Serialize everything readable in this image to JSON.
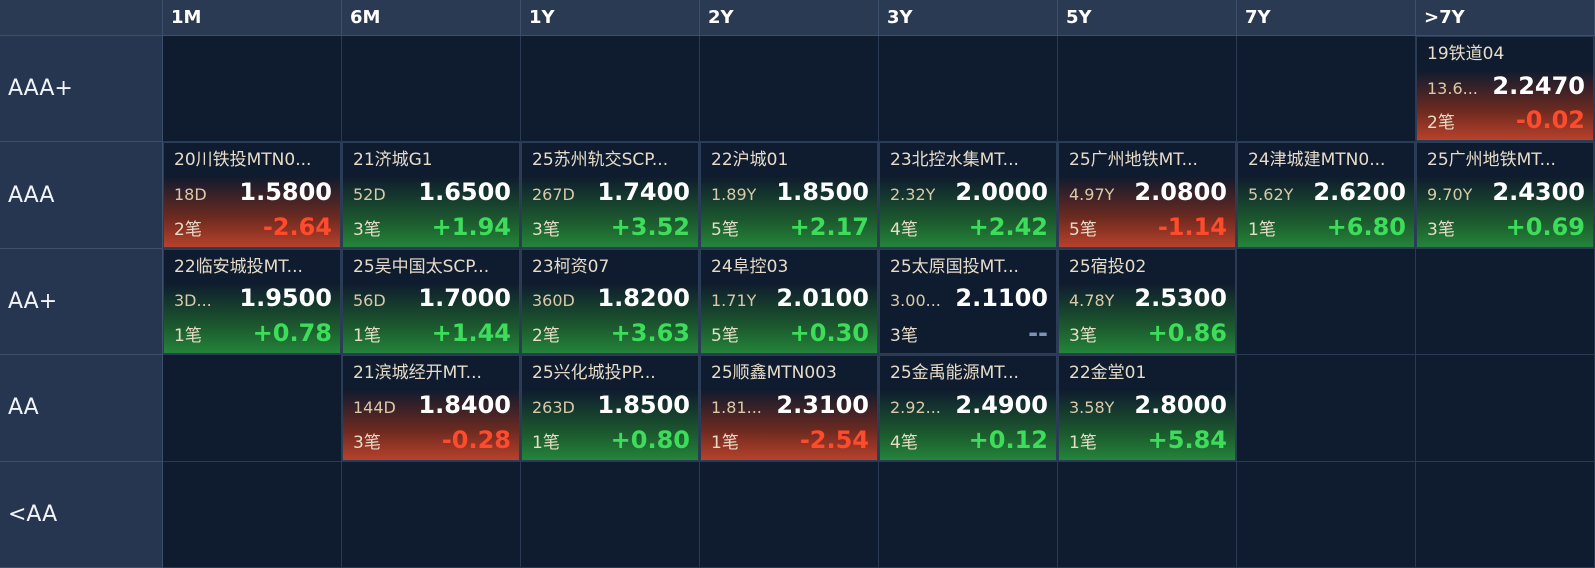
{
  "columns": [
    "1M",
    "6M",
    "1Y",
    "2Y",
    "3Y",
    "5Y",
    "7Y",
    ">7Y"
  ],
  "rows": [
    {
      "label": "AAA+",
      "cells": [
        null,
        null,
        null,
        null,
        null,
        null,
        null,
        {
          "name": "19铁道04",
          "term": "13.6...",
          "price": "2.2470",
          "count": "2笔",
          "change": "-0.02",
          "trend": "down"
        }
      ]
    },
    {
      "label": "AAA",
      "cells": [
        {
          "name": "20川铁投MTN0...",
          "term": "18D",
          "price": "1.5800",
          "count": "2笔",
          "change": "-2.64",
          "trend": "down"
        },
        {
          "name": "21济城G1",
          "term": "52D",
          "price": "1.6500",
          "count": "3笔",
          "change": "+1.94",
          "trend": "up"
        },
        {
          "name": "25苏州轨交SCP...",
          "term": "267D",
          "price": "1.7400",
          "count": "3笔",
          "change": "+3.52",
          "trend": "up"
        },
        {
          "name": "22沪城01",
          "term": "1.89Y",
          "price": "1.8500",
          "count": "5笔",
          "change": "+2.17",
          "trend": "up"
        },
        {
          "name": "23北控水集MT...",
          "term": "2.32Y",
          "price": "2.0000",
          "count": "4笔",
          "change": "+2.42",
          "trend": "up"
        },
        {
          "name": "25广州地铁MT...",
          "term": "4.97Y",
          "price": "2.0800",
          "count": "5笔",
          "change": "-1.14",
          "trend": "down"
        },
        {
          "name": "24津城建MTN0...",
          "term": "5.62Y",
          "price": "2.6200",
          "count": "1笔",
          "change": "+6.80",
          "trend": "up"
        },
        {
          "name": "25广州地铁MT...",
          "term": "9.70Y",
          "price": "2.4300",
          "count": "3笔",
          "change": "+0.69",
          "trend": "up"
        }
      ]
    },
    {
      "label": "AA+",
      "cells": [
        {
          "name": "22临安城投MT...",
          "term": "3D...",
          "price": "1.9500",
          "count": "1笔",
          "change": "+0.78",
          "trend": "up"
        },
        {
          "name": "25吴中国太SCP...",
          "term": "56D",
          "price": "1.7000",
          "count": "1笔",
          "change": "+1.44",
          "trend": "up"
        },
        {
          "name": "23柯资07",
          "term": "360D",
          "price": "1.8200",
          "count": "2笔",
          "change": "+3.63",
          "trend": "up"
        },
        {
          "name": "24阜控03",
          "term": "1.71Y",
          "price": "2.0100",
          "count": "5笔",
          "change": "+0.30",
          "trend": "up"
        },
        {
          "name": "25太原国投MT...",
          "term": "3.00...",
          "price": "2.1100",
          "count": "3笔",
          "change": "--",
          "trend": "flat"
        },
        {
          "name": "25宿投02",
          "term": "4.78Y",
          "price": "2.5300",
          "count": "3笔",
          "change": "+0.86",
          "trend": "up"
        },
        null,
        null
      ]
    },
    {
      "label": "AA",
      "cells": [
        null,
        {
          "name": "21滨城经开MT...",
          "term": "144D",
          "price": "1.8400",
          "count": "3笔",
          "change": "-0.28",
          "trend": "down"
        },
        {
          "name": "25兴化城投PP...",
          "term": "263D",
          "price": "1.8500",
          "count": "1笔",
          "change": "+0.80",
          "trend": "up"
        },
        {
          "name": "25顺鑫MTN003",
          "term": "1.81...",
          "price": "2.3100",
          "count": "1笔",
          "change": "-2.54",
          "trend": "down"
        },
        {
          "name": "25金禹能源MT...",
          "term": "2.92...",
          "price": "2.4900",
          "count": "4笔",
          "change": "+0.12",
          "trend": "up"
        },
        {
          "name": "22金堂01",
          "term": "3.58Y",
          "price": "2.8000",
          "count": "1笔",
          "change": "+5.84",
          "trend": "up"
        },
        null,
        null
      ]
    },
    {
      "label": "<AA",
      "cells": [
        null,
        null,
        null,
        null,
        null,
        null,
        null,
        null
      ]
    }
  ]
}
